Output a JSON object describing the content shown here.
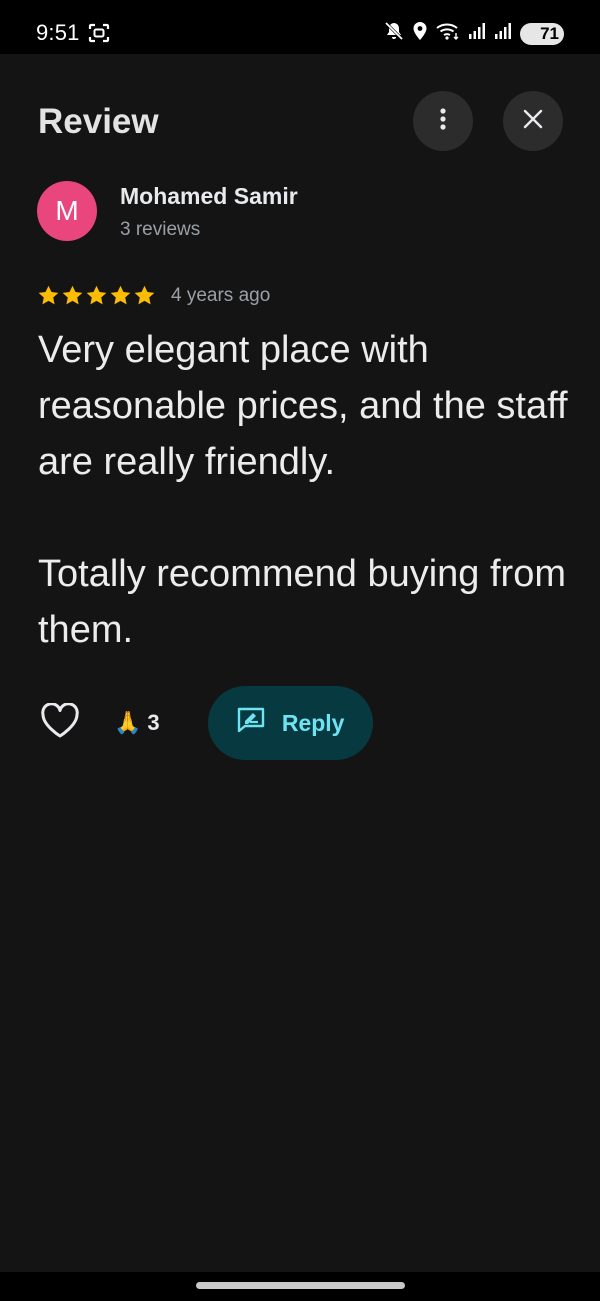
{
  "status_bar": {
    "time": "9:51",
    "battery": "71",
    "icons": [
      "screenshot-icon",
      "mute-icon",
      "location-icon",
      "wifi-icon",
      "signal-icon",
      "signal-icon"
    ]
  },
  "header": {
    "title": "Review",
    "more_icon": "more-vert-icon",
    "close_icon": "close-icon"
  },
  "author": {
    "initial": "M",
    "name": "Mohamed Samir",
    "meta": "3 reviews",
    "avatar_color": "#e8467c"
  },
  "rating": {
    "stars": 5,
    "max_stars": 5,
    "time_ago": "4 years ago",
    "star_color": "#fbbc04"
  },
  "review": {
    "text": "Very elegant place with reasonable prices, and the staff are really friendly.\n\nTotally recommend buying from them."
  },
  "actions": {
    "reaction_emoji": "🙏",
    "reaction_count": "3",
    "reply_label": "Reply",
    "reply_bg": "#063a40",
    "reply_color": "#6fe3f2"
  }
}
